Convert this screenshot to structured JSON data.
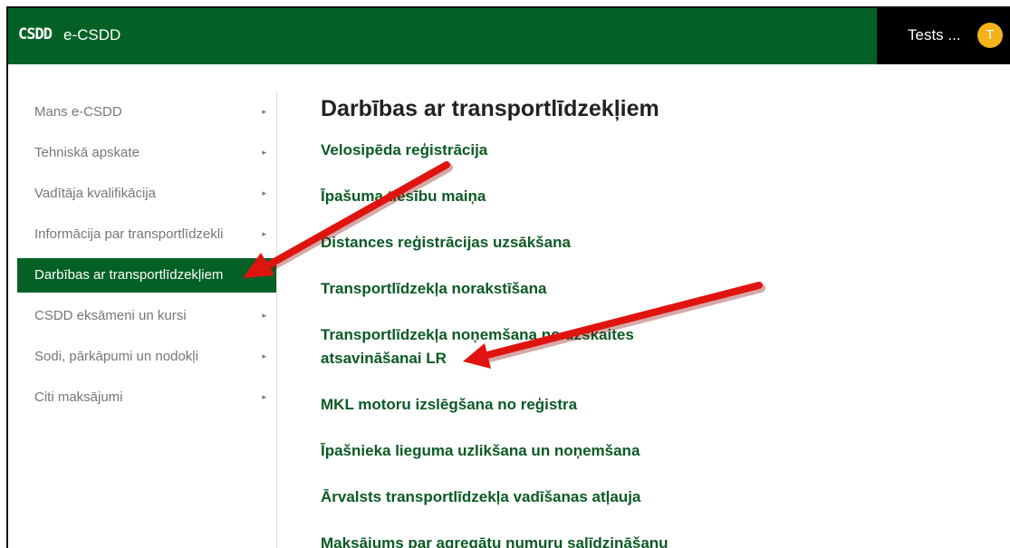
{
  "header": {
    "logo_text": "CSDD",
    "brand": "e-CSDD",
    "username": "Tests ...",
    "avatar_initial": "T"
  },
  "sidebar": {
    "items": [
      {
        "label": "Mans e-CSDD",
        "has_chevron": true
      },
      {
        "label": "Tehniskā apskate",
        "has_chevron": true
      },
      {
        "label": "Vadītāja kvalifikācija",
        "has_chevron": true
      },
      {
        "label": "Informācija par transportlīdzekli",
        "has_chevron": true
      },
      {
        "label": "Darbības ar transportlīdzekļiem",
        "active": true,
        "has_chevron": false
      },
      {
        "label": "CSDD eksāmeni un kursi",
        "has_chevron": true
      },
      {
        "label": "Sodi, pārkāpumi un nodokļi",
        "has_chevron": true
      },
      {
        "label": "Citi maksājumi",
        "has_chevron": true
      }
    ],
    "chevron_icon": "chevron-right-icon"
  },
  "main": {
    "title": "Darbības ar transportlīdzekļiem",
    "actions": [
      "Velosipēda reģistrācija",
      "Īpašuma tiesību maiņa",
      "Distances reģistrācijas uzsākšana",
      "Transportlīdzekļa norakstīšana",
      "Transportlīdzekļa noņemšana no uzskaites atsavināšanai LR",
      "MKL motoru izslēgšana no reģistra",
      "Īpašnieka lieguma uzlikšana un noņemšana",
      "Ārvalsts transportlīdzekļa vadīšanas atļauja",
      "Maksājums par agregātu numuru salīdzināšanu"
    ]
  },
  "colors": {
    "brand_green": "#046126",
    "link_green": "#0a5a22",
    "avatar": "#f5b21b",
    "annotation_arrow": "#e0140f"
  },
  "annotations": {
    "arrow_icon": "red-arrow-annotation"
  }
}
